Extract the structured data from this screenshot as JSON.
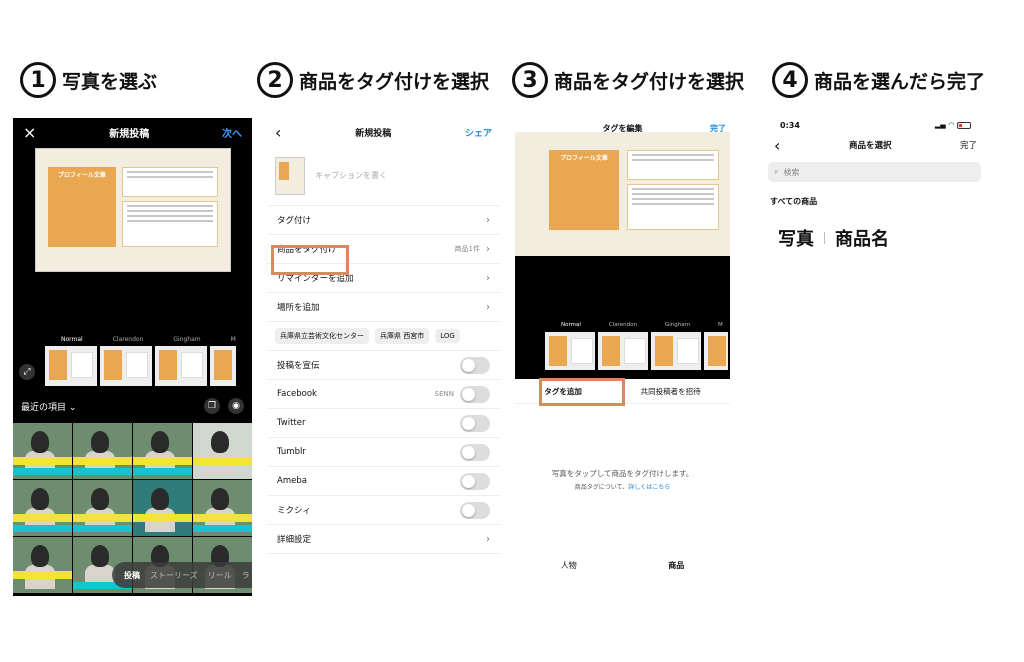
{
  "steps": [
    {
      "number": "1",
      "title": "写真を選ぶ"
    },
    {
      "number": "2",
      "title": "商品をタグ付けを選択"
    },
    {
      "number": "3",
      "title": "商品をタグ付けを選択"
    },
    {
      "number": "4",
      "title": "商品を選んだら完了"
    }
  ],
  "panel1": {
    "close_icon": "×",
    "title": "新規投稿",
    "next_label": "次へ",
    "card_title": "プロフィール文章",
    "filters": [
      "Normal",
      "Clarendon",
      "Gingham",
      "M"
    ],
    "recent_label": "最近の項目",
    "chevron": "⌄",
    "modes": [
      "投稿",
      "ストーリーズ",
      "リール",
      "ラ"
    ]
  },
  "panel2": {
    "back": "‹",
    "title": "新規投稿",
    "share_label": "シェア",
    "caption_placeholder": "キャプションを書く",
    "rows": [
      {
        "label": "タグ付け",
        "right": ""
      },
      {
        "label": "商品をタグ付け",
        "right": "商品1件"
      },
      {
        "label": "リマインダーを追加",
        "right": ""
      },
      {
        "label": "場所を追加",
        "right": ""
      }
    ],
    "chips": [
      "兵庫県立芸術文化センター",
      "兵庫県 西宮市",
      "LOG"
    ],
    "toggles": [
      {
        "label": "投稿を宣伝",
        "right": ""
      },
      {
        "label": "Facebook",
        "right": "SENN"
      },
      {
        "label": "Twitter",
        "right": ""
      },
      {
        "label": "Tumblr",
        "right": ""
      },
      {
        "label": "Ameba",
        "right": ""
      },
      {
        "label": "ミクシィ",
        "right": ""
      }
    ],
    "advanced_label": "詳細設定"
  },
  "panel3": {
    "title": "タグを編集",
    "done_label": "完了",
    "card_title": "プロフィール文章",
    "filters": [
      "Normal",
      "Clarendon",
      "Gingham",
      "M"
    ],
    "tab_add": "タグを追加",
    "tab_invite": "共同投稿者を招待",
    "hint": "写真をタップして商品をタグ付けします。",
    "hint2_prefix": "商品タグについて、",
    "hint2_link": "詳しくはこちら",
    "bottom_tabs": [
      "人物",
      "商品"
    ]
  },
  "panel4": {
    "time": "0:34",
    "back": "‹",
    "title": "商品を選択",
    "done_label": "完了",
    "search_placeholder": "検索",
    "all_products": "すべての商品",
    "photo_label": "写真",
    "product_name_label": "商品名"
  },
  "colors": {
    "accent": "#1a88e0",
    "highlight": "#d78a5e",
    "card": "#e9a752"
  }
}
